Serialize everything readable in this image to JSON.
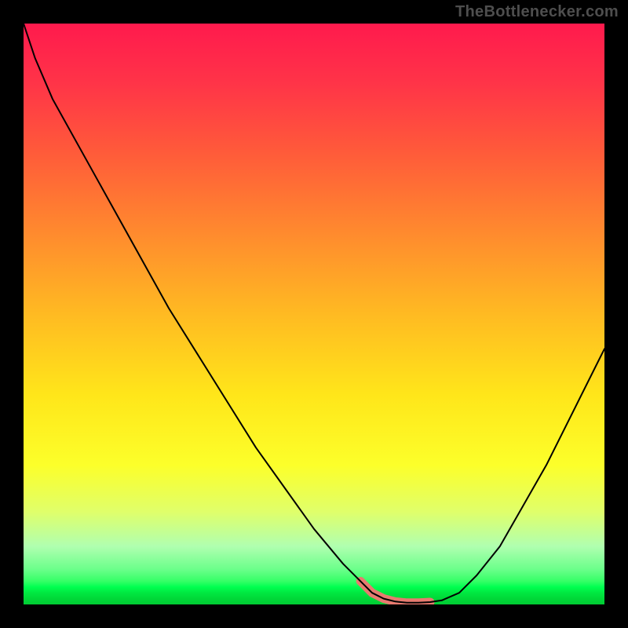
{
  "watermark": "TheBottlenecker.com",
  "chart_data": {
    "type": "line",
    "title": "",
    "xlabel": "",
    "ylabel": "",
    "xlim": [
      0,
      100
    ],
    "ylim": [
      0,
      100
    ],
    "x": [
      0,
      2,
      5,
      10,
      15,
      20,
      25,
      30,
      35,
      40,
      45,
      50,
      55,
      58,
      60,
      62,
      64,
      66,
      68,
      70,
      72,
      75,
      78,
      82,
      86,
      90,
      95,
      100
    ],
    "values": [
      100,
      94,
      87,
      78,
      69,
      60,
      51,
      43,
      35,
      27,
      20,
      13,
      7,
      4,
      2,
      1,
      0.5,
      0.3,
      0.3,
      0.4,
      0.7,
      2,
      5,
      10,
      17,
      24,
      34,
      44
    ],
    "highlight_x_range": [
      58,
      70
    ],
    "grid": false,
    "legend": false
  },
  "colors": {
    "background_black": "#000000",
    "curve": "#000000",
    "highlight": "#e77a6f",
    "gradient_top": "#ff1a4d",
    "gradient_bottom": "#00cc33"
  }
}
